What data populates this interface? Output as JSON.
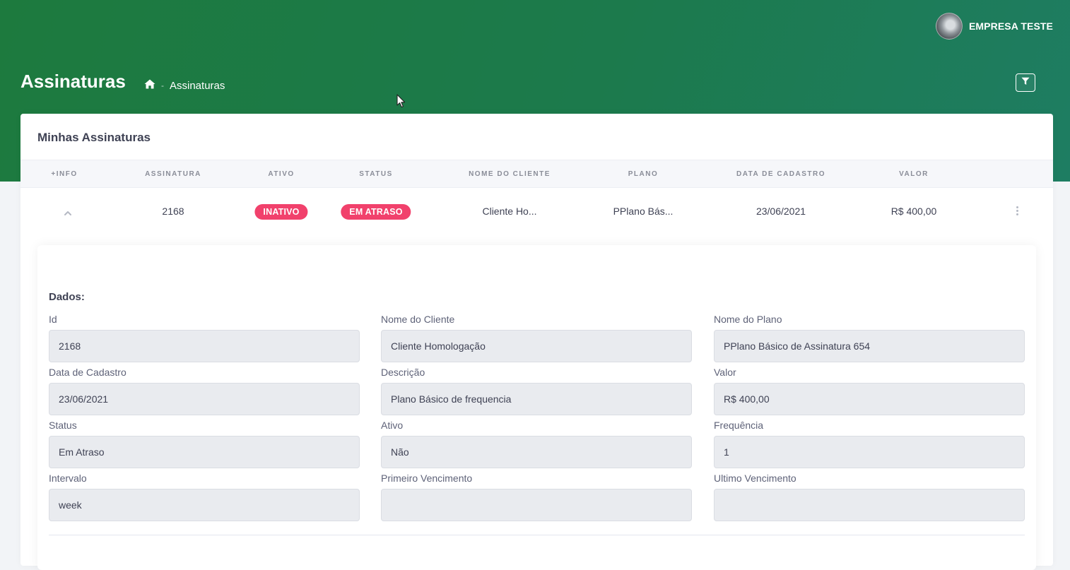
{
  "user": {
    "name": "EMPRESA TESTE"
  },
  "page": {
    "title": "Assinaturas"
  },
  "breadcrumb": {
    "separator": "-",
    "current": "Assinaturas"
  },
  "card": {
    "title": "Minhas Assinaturas"
  },
  "table": {
    "headers": [
      "+INFO",
      "ASSINATURA",
      "ATIVO",
      "STATUS",
      "NOME DO CLIENTE",
      "PLANO",
      "DATA DE CADASTRO",
      "VALOR"
    ],
    "row": {
      "id": "2168",
      "ativo": "INATIVO",
      "status": "EM ATRASO",
      "cliente": "Cliente Ho...",
      "plano": "PPlano Bás...",
      "data": "23/06/2021",
      "valor": "R$ 400,00"
    }
  },
  "details": {
    "title": "Dados:",
    "fields": [
      {
        "label": "Id",
        "value": "2168"
      },
      {
        "label": "Nome do Cliente",
        "value": "Cliente Homologação"
      },
      {
        "label": "Nome do Plano",
        "value": "PPlano Básico de Assinatura 654"
      },
      {
        "label": "Data de Cadastro",
        "value": "23/06/2021"
      },
      {
        "label": "Descrição",
        "value": "Plano Básico de frequencia"
      },
      {
        "label": "Valor",
        "value": "R$ 400,00"
      },
      {
        "label": "Status",
        "value": "Em Atraso"
      },
      {
        "label": "Ativo",
        "value": "Não"
      },
      {
        "label": "Frequência",
        "value": "1"
      },
      {
        "label": "Intervalo",
        "value": "week"
      },
      {
        "label": "Primeiro Vencimento",
        "value": ""
      },
      {
        "label": "Ultimo Vencimento",
        "value": ""
      }
    ]
  },
  "icons": {
    "home": "home-icon",
    "filter": "filter-icon",
    "chevron": "chevron-up-icon",
    "more": "more-vertical-icon",
    "avatar": "avatar"
  },
  "colors": {
    "header_gradient_start": "#1d7a3e",
    "header_gradient_end": "#1e7d62",
    "badge_danger": "#f1416c"
  }
}
